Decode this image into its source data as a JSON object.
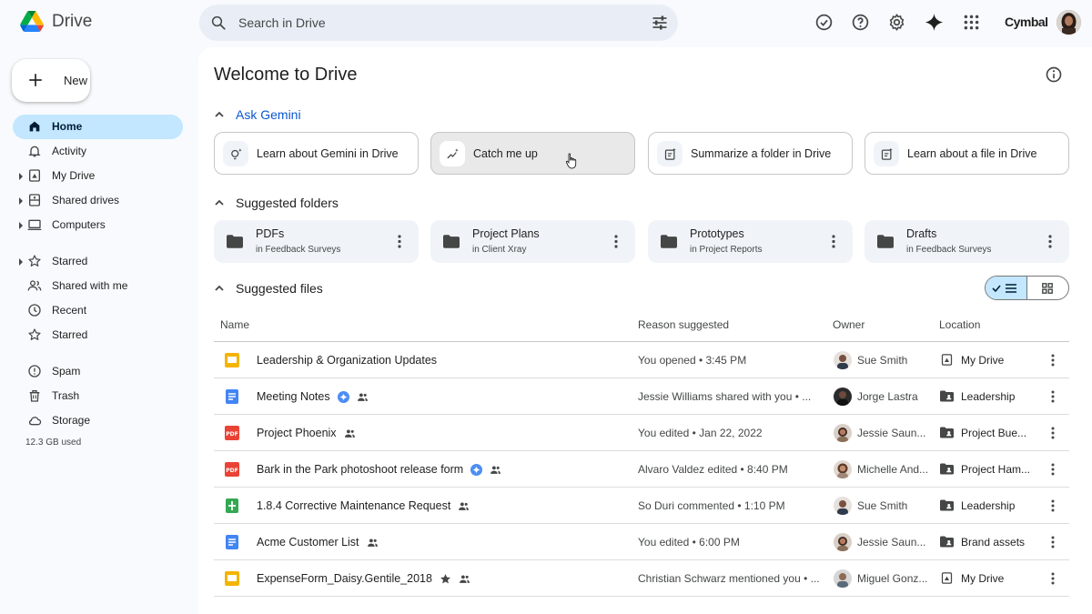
{
  "app": {
    "name": "Drive"
  },
  "search": {
    "placeholder": "Search in Drive"
  },
  "header": {
    "brand": "Cymbal"
  },
  "sidebar": {
    "new_label": "New",
    "items": [
      {
        "label": "Home"
      },
      {
        "label": "Activity"
      },
      {
        "label": "My Drive"
      },
      {
        "label": "Shared drives"
      },
      {
        "label": "Computers"
      },
      {
        "label": "Starred"
      },
      {
        "label": "Shared with me"
      },
      {
        "label": "Recent"
      },
      {
        "label": "Starred"
      },
      {
        "label": "Spam"
      },
      {
        "label": "Trash"
      },
      {
        "label": "Storage"
      }
    ],
    "storage_used": "12.3 GB used"
  },
  "main": {
    "title": "Welcome to Drive",
    "gemini": {
      "heading": "Ask Gemini",
      "chips": [
        {
          "label": "Learn about Gemini in Drive"
        },
        {
          "label": "Catch me up"
        },
        {
          "label": "Summarize a folder in Drive"
        },
        {
          "label": "Learn about a file in Drive"
        }
      ]
    },
    "folders": {
      "heading": "Suggested folders",
      "items": [
        {
          "name": "PDFs",
          "location": "in Feedback Surveys"
        },
        {
          "name": "Project Plans",
          "location": "in Client Xray"
        },
        {
          "name": "Prototypes",
          "location": "in Project Reports"
        },
        {
          "name": "Drafts",
          "location": "in Feedback Surveys"
        }
      ]
    },
    "files": {
      "heading": "Suggested files",
      "columns": {
        "name": "Name",
        "reason": "Reason suggested",
        "owner": "Owner",
        "location": "Location"
      },
      "rows": [
        {
          "name": "Leadership & Organization Updates",
          "reason": "You opened • 3:45 PM",
          "owner": "Sue Smith",
          "location": "My Drive"
        },
        {
          "name": "Meeting Notes",
          "reason": "Jessie Williams shared with you • ...",
          "owner": "Jorge Lastra",
          "location": "Leadership"
        },
        {
          "name": "Project Phoenix",
          "reason": "You edited • Jan 22, 2022",
          "owner": "Jessie Saun...",
          "location": "Project Bue..."
        },
        {
          "name": "Bark in the Park photoshoot release form",
          "reason": "Alvaro Valdez edited • 8:40 PM",
          "owner": "Michelle And...",
          "location": "Project Ham..."
        },
        {
          "name": "1.8.4 Corrective Maintenance Request",
          "reason": "So Duri commented • 1:10 PM",
          "owner": "Sue Smith",
          "location": "Leadership"
        },
        {
          "name": "Acme Customer List",
          "reason": "You edited • 6:00 PM",
          "owner": "Jessie Saun...",
          "location": "Brand assets"
        },
        {
          "name": "ExpenseForm_Daisy.Gentile_2018",
          "reason": "Christian Schwarz mentioned you • ...",
          "owner": "Miguel Gonz...",
          "location": "My Drive"
        }
      ]
    }
  },
  "colors": {
    "accent": "#0b57d0",
    "active_nav": "#c2e7ff",
    "slides": "#f4b400",
    "docs": "#4285f4",
    "pdf": "#ea4335",
    "sheets": "#34a853"
  }
}
